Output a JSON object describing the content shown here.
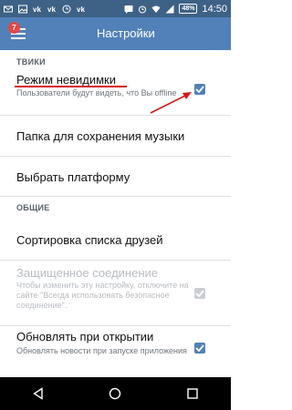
{
  "status_bar": {
    "icons": [
      "mail-icon",
      "image-icon",
      "vk-icon",
      "vk-icon",
      "clock-icon",
      "vk-icon",
      "messenger-icon",
      "alarm-icon",
      "wifi-icon",
      "signal-icon",
      "battery-icon"
    ],
    "battery": "48%",
    "time": "14:50"
  },
  "toolbar": {
    "title": "Настройки",
    "badge": "7",
    "color": "#5181b8"
  },
  "sections": {
    "tweaks": {
      "header": "ТВИКИ"
    },
    "general": {
      "header": "ОБЩИЕ"
    }
  },
  "items": {
    "invisible": {
      "title": "Режим невидимки",
      "subtitle": "Пользователи будут видеть, что Вы offline",
      "checked": true
    },
    "music_folder": {
      "title": "Папка для сохранения музыки"
    },
    "platform": {
      "title": "Выбрать платформу"
    },
    "friends_sort": {
      "title": "Сортировка списка друзей"
    },
    "secure": {
      "title": "Защищенное соединение",
      "subtitle": "Чтобы изменить эту настройку, отключите на сайте \"Всегда использовать безопасное соединение\".",
      "checked": true,
      "enabled": false
    },
    "update_on_open": {
      "title": "Обновлять при открытии",
      "subtitle": "Обновлять новости при запуске приложения",
      "checked": true
    }
  },
  "annotation_color": "#d3191b"
}
